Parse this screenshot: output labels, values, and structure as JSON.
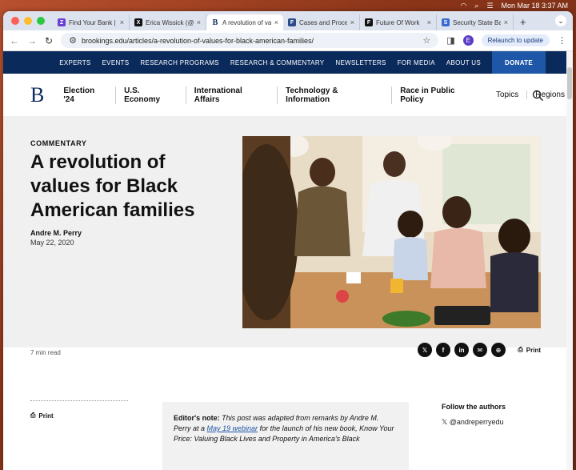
{
  "menubar": {
    "datetime": "Mon Mar 18  3:37 AM"
  },
  "tabs": [
    {
      "label": "Find Your Bank | ",
      "fav": "Z",
      "color": "#6b3fd1"
    },
    {
      "label": "Erica Wissick (@",
      "fav": "X",
      "color": "#111111"
    },
    {
      "label": "A revolution of va",
      "fav": "B",
      "color": "#0a2a5c"
    },
    {
      "label": "Cases and Proce",
      "fav": "F",
      "color": "#2a4a8a"
    },
    {
      "label": "Future Of Work",
      "fav": "F",
      "color": "#111111"
    },
    {
      "label": "Security State Ba",
      "fav": "S",
      "color": "#3a6ad1"
    }
  ],
  "toolbar": {
    "url": "brookings.edu/articles/a-revolution-of-values-for-black-american-families/",
    "avatar": "E",
    "relaunch": "Relaunch to update"
  },
  "topnav": [
    "EXPERTS",
    "EVENTS",
    "RESEARCH PROGRAMS",
    "RESEARCH & COMMENTARY",
    "NEWSLETTERS",
    "FOR MEDIA",
    "ABOUT US"
  ],
  "donate": "DONATE",
  "logo": "B",
  "mainnav": [
    "Election '24",
    "U.S. Economy",
    "International Affairs",
    "Technology & Information",
    "Race in Public Policy",
    "Topics",
    "Regions"
  ],
  "article": {
    "kicker": "COMMENTARY",
    "headline": "A revolution of values for Black American families",
    "author": "Andre M. Perry",
    "date": "May 22, 2020",
    "read_time": "7 min read",
    "print": "Print"
  },
  "share": [
    "𝕏",
    "f",
    "in",
    "✉",
    "⊕"
  ],
  "editor_note": {
    "label": "Editor's note:",
    "text_before": " This post was adapted from remarks by Andre M. Perry at a ",
    "link": "May 19 webinar",
    "text_after": " for the launch of his new book, Know Your Price: Valuing Black Lives and Property in America's Black"
  },
  "follow": {
    "title": "Follow the authors",
    "handle": "@andreperryedu"
  }
}
